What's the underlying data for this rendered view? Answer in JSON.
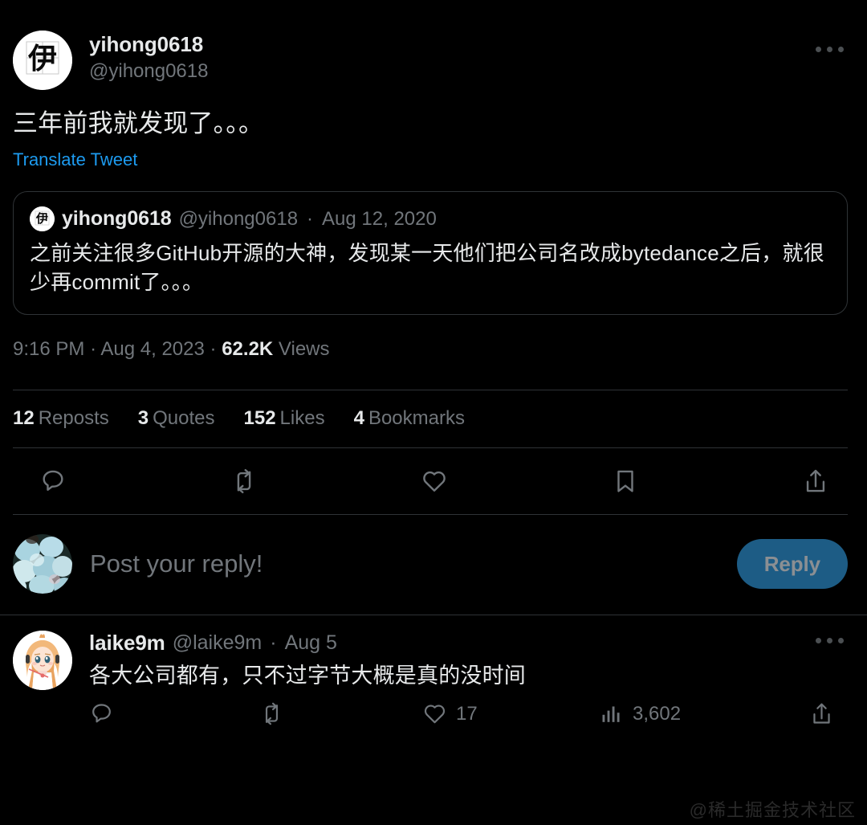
{
  "theme": {
    "background": "#000000",
    "text_primary": "#e7e9ea",
    "text_secondary": "#71767b",
    "link_blue": "#1d9bf0",
    "border": "#2f3336",
    "reply_button_bg": "#1d5c85",
    "reply_button_text": "#8b8f93",
    "watermark_color": "#2a2a2a"
  },
  "main_tweet": {
    "author": {
      "display_name": "yihong0618",
      "handle": "@yihong0618",
      "avatar_character": "伊"
    },
    "more_menu_label": "More",
    "text": "三年前我就发现了。。。",
    "translate_label": "Translate Tweet",
    "quoted_tweet": {
      "display_name": "yihong0618",
      "handle": "@yihong0618",
      "separator": "·",
      "date": "Aug 12, 2020",
      "avatar_character": "伊",
      "text": "之前关注很多GitHub开源的大神，发现某一天他们把公司名改成bytedance之后，就很少再commit了。。。"
    },
    "timestamp": {
      "time": "9:16 PM",
      "sep1": "·",
      "date": "Aug 4, 2023",
      "sep2": "·",
      "views_count": "62.2K",
      "views_label": "Views"
    },
    "stats": [
      {
        "count": "12",
        "label": "Reposts"
      },
      {
        "count": "3",
        "label": "Quotes"
      },
      {
        "count": "152",
        "label": "Likes"
      },
      {
        "count": "4",
        "label": "Bookmarks"
      }
    ],
    "actions": [
      {
        "icon": "reply-icon",
        "label": "Reply"
      },
      {
        "icon": "retweet-icon",
        "label": "Repost"
      },
      {
        "icon": "heart-icon",
        "label": "Like"
      },
      {
        "icon": "bookmark-icon",
        "label": "Bookmark"
      },
      {
        "icon": "share-icon",
        "label": "Share"
      }
    ]
  },
  "reply_composer": {
    "placeholder": "Post your reply!",
    "button_label": "Reply",
    "avatar_description": "blue-flowers-photo"
  },
  "replies": [
    {
      "display_name": "laike9m",
      "handle": "@laike9m",
      "separator": "·",
      "date": "Aug 5",
      "avatar_description": "anime-girl-avatar",
      "text": "各大公司都有，只不过字节大概是真的没时间",
      "more_menu_label": "More",
      "actions": [
        {
          "icon": "reply-icon",
          "label": "Reply",
          "count": ""
        },
        {
          "icon": "retweet-icon",
          "label": "Repost",
          "count": ""
        },
        {
          "icon": "heart-icon",
          "label": "Like",
          "count": "17"
        },
        {
          "icon": "views-icon",
          "label": "Views",
          "count": "3,602"
        },
        {
          "icon": "share-icon",
          "label": "Share",
          "count": ""
        }
      ]
    }
  ],
  "watermark": "@稀土掘金技术社区"
}
